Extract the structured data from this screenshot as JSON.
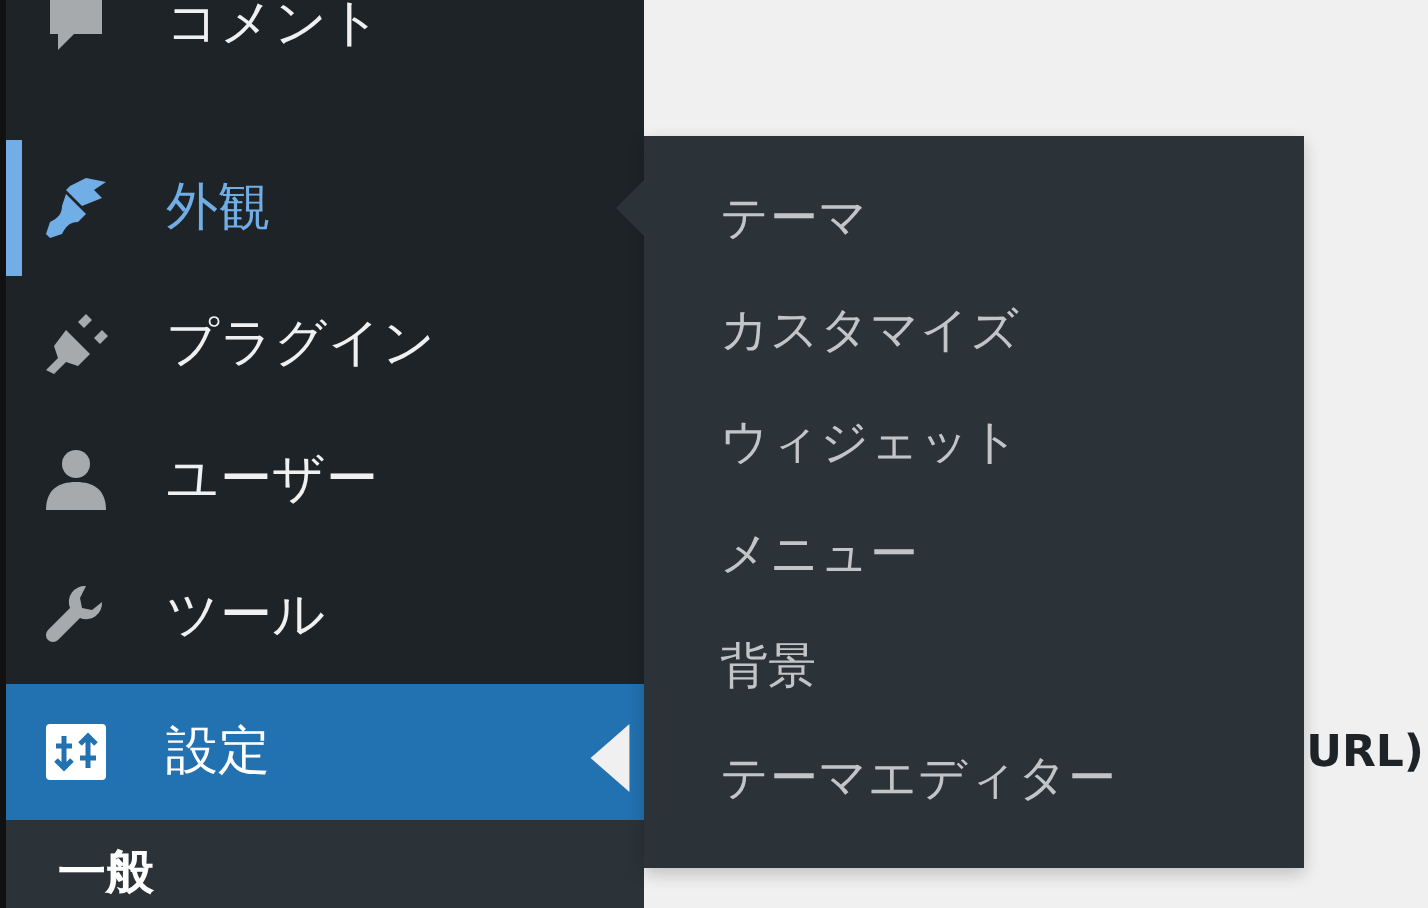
{
  "sidebar": {
    "items": [
      {
        "label": "コメント",
        "hovered": false,
        "current": false
      },
      {
        "label": "外観",
        "hovered": true,
        "current": false
      },
      {
        "label": "プラグイン",
        "hovered": false,
        "current": false
      },
      {
        "label": "ユーザー",
        "hovered": false,
        "current": false
      },
      {
        "label": "ツール",
        "hovered": false,
        "current": false
      },
      {
        "label": "設定",
        "hovered": false,
        "current": true
      }
    ],
    "submenu": [
      "一般"
    ]
  },
  "flyout": {
    "items": [
      "テーマ",
      "カスタマイズ",
      "ウィジェット",
      "メニュー",
      "背景",
      "テーマエディター"
    ]
  },
  "main": {
    "text": "URL)"
  }
}
